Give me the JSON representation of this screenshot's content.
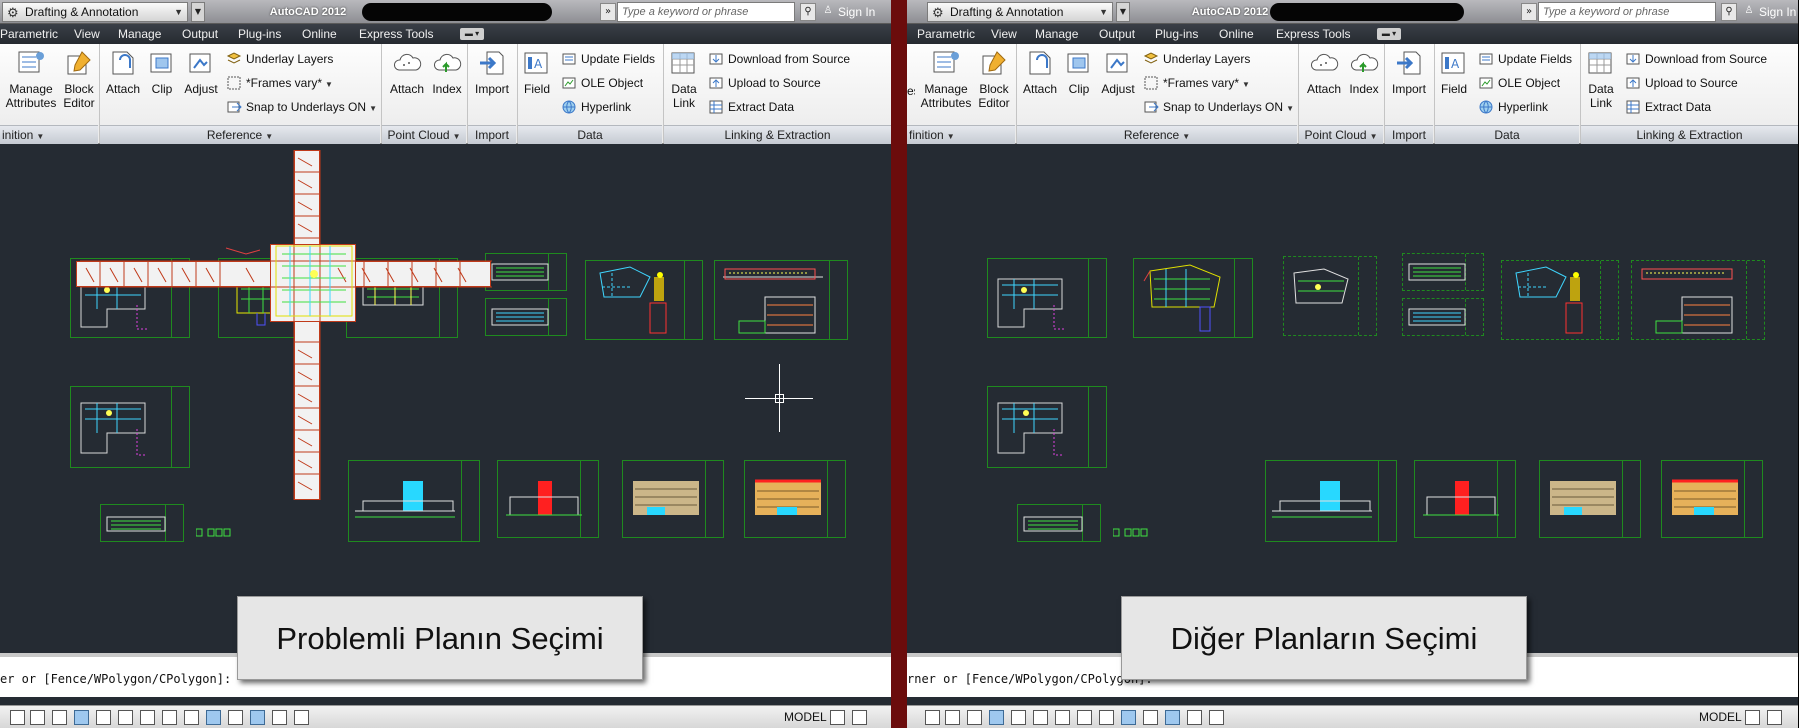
{
  "app": {
    "workspace": "Drafting & Annotation",
    "title": "AutoCAD 2012",
    "search_placeholder": "Type a keyword or phrase",
    "sign_in": "Sign In",
    "tabs": [
      "Parametric",
      "View",
      "Manage",
      "Output",
      "Plug-ins",
      "Online",
      "Express Tools"
    ]
  },
  "ribbon": {
    "block_definition": {
      "title_fragment": "inition",
      "title_fragment_right": "finition",
      "manage_attributes_line1": "Manage",
      "manage_attributes_line2": "Attributes",
      "block_editor_line1": "Block",
      "block_editor_line2": "Editor",
      "left_fragment": "es"
    },
    "reference": {
      "title": "Reference",
      "attach": "Attach",
      "clip": "Clip",
      "adjust": "Adjust",
      "underlay_layers": "Underlay Layers",
      "frames_vary": "*Frames vary*",
      "snap_to_underlays": "Snap to Underlays ON"
    },
    "point_cloud": {
      "title": "Point Cloud",
      "attach": "Attach",
      "index": "Index"
    },
    "import": {
      "title": "Import",
      "import": "Import"
    },
    "data": {
      "title": "Data",
      "field": "Field",
      "update_fields": "Update Fields",
      "ole_object": "OLE Object",
      "hyperlink": "Hyperlink"
    },
    "linking": {
      "title": "Linking & Extraction",
      "data_link_line1": "Data",
      "data_link_line2": "Link",
      "download_from_source": "Download from Source",
      "upload_to_source": "Upload to Source",
      "extract_data": "Extract  Data"
    }
  },
  "command_line": {
    "left": "er or [Fence/WPolygon/CPolygon]:",
    "right": "rner or [Fence/WPolygon/CPolygon]:"
  },
  "status": {
    "model": "MODEL"
  },
  "captions": {
    "left": "Problemli Planın Seçimi",
    "right": "Diğer Planların Seçimi"
  },
  "colors": {
    "drawing_background": "#252b33",
    "sheet_border": "#1f8a1f",
    "divider": "#6b0c0c",
    "selection_highlight": "#f2f2f2"
  }
}
